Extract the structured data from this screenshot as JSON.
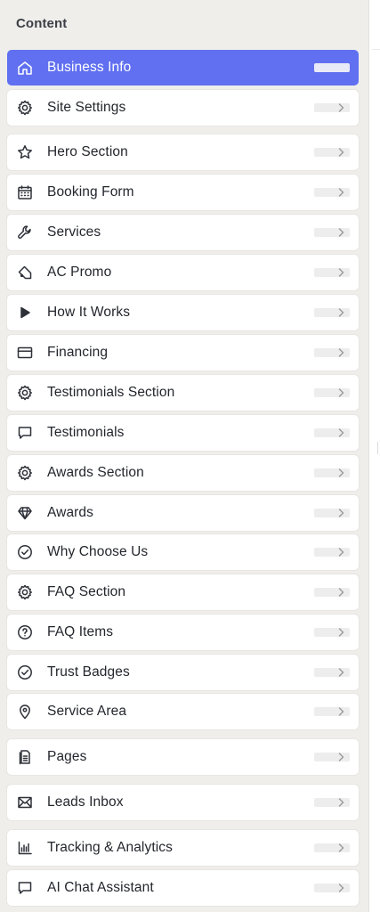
{
  "sidebar": {
    "heading": "Content",
    "accent_color": "#6170f0",
    "items": [
      {
        "label": "Business Info",
        "icon": "home-icon",
        "active": true
      },
      {
        "label": "Site Settings",
        "icon": "gear-icon"
      },
      {
        "label": "Hero Section",
        "icon": "star-icon"
      },
      {
        "label": "Booking Form",
        "icon": "calendar-icon"
      },
      {
        "label": "Services",
        "icon": "wrench-icon"
      },
      {
        "label": "AC Promo",
        "icon": "tag-icon"
      },
      {
        "label": "How It Works",
        "icon": "play-icon"
      },
      {
        "label": "Financing",
        "icon": "credit-card-icon"
      },
      {
        "label": "Testimonials Section",
        "icon": "gear-icon"
      },
      {
        "label": "Testimonials",
        "icon": "chat-bubble-icon"
      },
      {
        "label": "Awards Section",
        "icon": "gear-icon"
      },
      {
        "label": "Awards",
        "icon": "diamond-icon"
      },
      {
        "label": "Why Choose Us",
        "icon": "check-circle-icon"
      },
      {
        "label": "FAQ Section",
        "icon": "gear-icon"
      },
      {
        "label": "FAQ Items",
        "icon": "question-circle-icon"
      },
      {
        "label": "Trust Badges",
        "icon": "check-circle-icon"
      },
      {
        "label": "Service Area",
        "icon": "map-pin-icon"
      },
      {
        "label": "Pages",
        "icon": "document-icon"
      },
      {
        "label": "Leads Inbox",
        "icon": "envelope-icon"
      },
      {
        "label": "Tracking & Analytics",
        "icon": "bar-chart-icon"
      },
      {
        "label": "AI Chat Assistant",
        "icon": "chat-bubble-icon"
      }
    ]
  }
}
